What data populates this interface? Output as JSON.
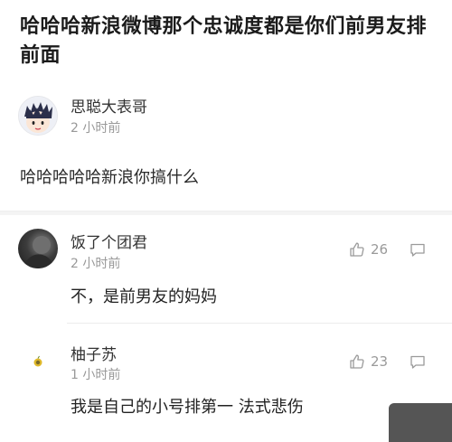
{
  "headline": "哈哈哈新浪微博那个忠诚度都是你们前男友排前面",
  "post": {
    "author": "思聪大表哥",
    "time": "2 小时前",
    "text": "哈哈哈哈哈新浪你搞什么"
  },
  "comments": [
    {
      "author": "饭了个团君",
      "time": "2 小时前",
      "text": "不，是前男友的妈妈",
      "likes": "26"
    },
    {
      "author": "柚子苏",
      "time": "1 小时前",
      "text": "我是自己的小号排第一 法式悲伤",
      "likes": "23"
    }
  ],
  "icons": {
    "like": "thumbs-up-icon",
    "reply": "comment-bubble-icon"
  }
}
